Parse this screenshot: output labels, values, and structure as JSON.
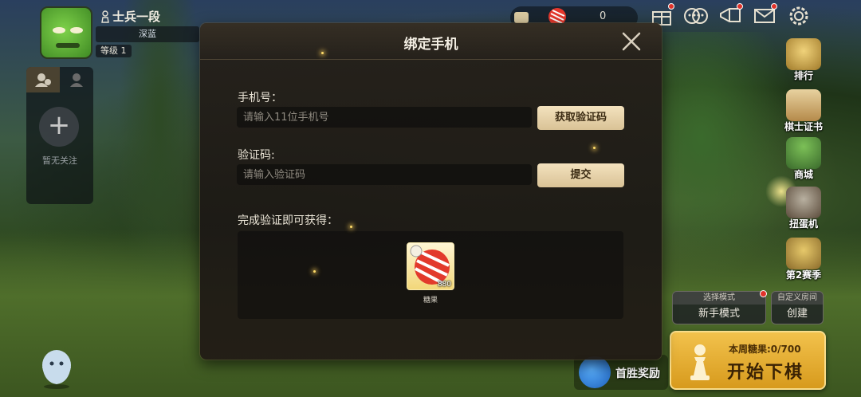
{
  "profile": {
    "rank": "士兵一段",
    "title": "深蓝",
    "level": "等级 1"
  },
  "follow": {
    "empty_label": "暂无关注"
  },
  "currency": {
    "value": "0"
  },
  "side_menu": [
    {
      "label": "排行",
      "icon": "trophy-icon"
    },
    {
      "label": "棋士证书",
      "icon": "certificate-icon"
    },
    {
      "label": "商城",
      "icon": "shop-icon"
    },
    {
      "label": "扭蛋机",
      "icon": "gacha-machine-icon"
    },
    {
      "label": "第2赛季",
      "icon": "season-icon"
    }
  ],
  "mode": {
    "select_header": "选择模式",
    "select_value": "新手模式",
    "custom_header": "自定义房间",
    "custom_value": "创建"
  },
  "start": {
    "weekly_candy": "本周糖果:0/700",
    "label": "开始下棋"
  },
  "first_win": {
    "label": "首胜奖励"
  },
  "modal": {
    "title": "绑定手机",
    "phone_label": "手机号：",
    "phone_placeholder": "请输入11位手机号",
    "get_code_label": "获取验证码",
    "code_label": "验证码:",
    "code_placeholder": "请输入验证码",
    "submit_label": "提交",
    "reward_title": "完成验证即可获得：",
    "reward": {
      "name": "糖果",
      "count": "880",
      "icon": "candy-icon"
    }
  },
  "colors": {
    "gold": "#f2c24c",
    "button_light": "#e8d4a8",
    "notification": "#e0322a"
  }
}
